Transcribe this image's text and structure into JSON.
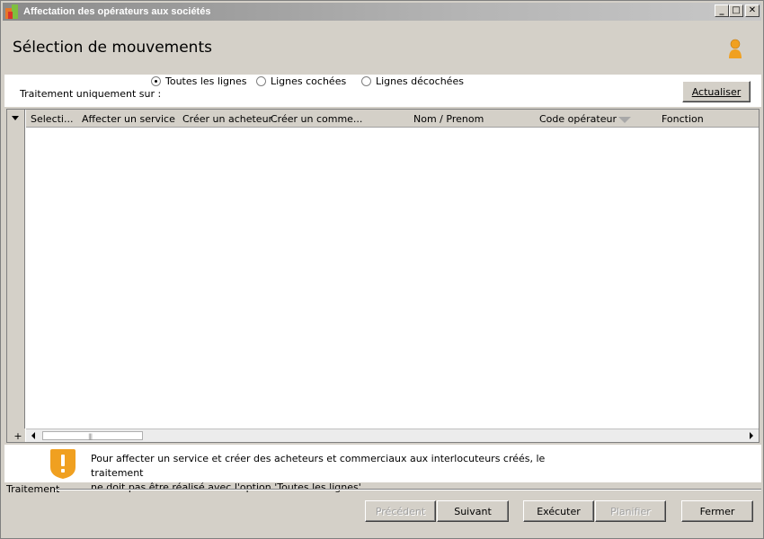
{
  "window": {
    "title": "Affectation des opérateurs aux sociétés",
    "minimize": "_",
    "maximize": "□",
    "close": "✕"
  },
  "header": {
    "title": "Sélection de mouvements"
  },
  "options": {
    "label": "Traitement uniquement sur :",
    "radios": [
      {
        "label": "Toutes les lignes",
        "selected": true
      },
      {
        "label": "Lignes cochées",
        "selected": false
      },
      {
        "label": "Lignes décochées",
        "selected": false
      }
    ],
    "refresh_label": "Actualiser"
  },
  "grid": {
    "columns": [
      "Selecti...",
      "Affecter un service",
      "Créer un acheteur",
      "Créer un comme...",
      "Nom / Prenom",
      "Code opérateur",
      "Fonction"
    ],
    "rows": [],
    "add_label": "+",
    "scroll_grip": "|||"
  },
  "info": {
    "line1": "Pour affecter un service et créer des acheteurs et commerciaux aux interlocuteurs créés, le traitement",
    "line2": "ne doit pas être réalisé avec l'option 'Toutes les lignes'."
  },
  "footer": {
    "group_label": "Traitement",
    "buttons": {
      "previous": "Précédent",
      "next": "Suivant",
      "execute": "Exécuter",
      "schedule": "Planifier",
      "close": "Fermer"
    }
  },
  "colors": {
    "accent_orange": "#f0a020",
    "panel_bg": "#d4d0c8",
    "disabled_text": "#a0a0a0"
  }
}
